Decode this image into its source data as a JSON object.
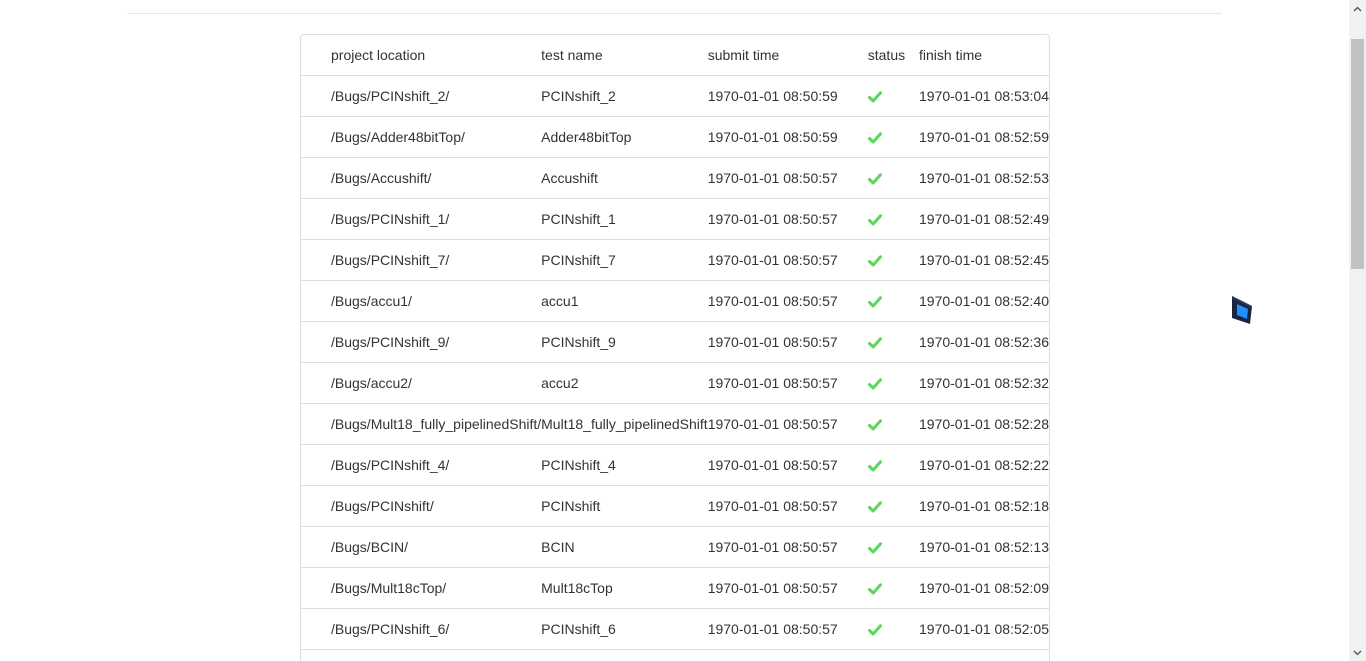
{
  "table": {
    "headers": {
      "project_location": "project location",
      "test_name": "test name",
      "submit_time": "submit time",
      "status": "status",
      "finish_time": "finish time"
    },
    "rows": [
      {
        "location": "/Bugs/PCINshift_2/",
        "name": "PCINshift_2",
        "submit": "1970-01-01 08:50:59",
        "status": "success",
        "finish": "1970-01-01 08:53:04"
      },
      {
        "location": "/Bugs/Adder48bitTop/",
        "name": "Adder48bitTop",
        "submit": "1970-01-01 08:50:59",
        "status": "success",
        "finish": "1970-01-01 08:52:59"
      },
      {
        "location": "/Bugs/Accushift/",
        "name": "Accushift",
        "submit": "1970-01-01 08:50:57",
        "status": "success",
        "finish": "1970-01-01 08:52:53"
      },
      {
        "location": "/Bugs/PCINshift_1/",
        "name": "PCINshift_1",
        "submit": "1970-01-01 08:50:57",
        "status": "success",
        "finish": "1970-01-01 08:52:49"
      },
      {
        "location": "/Bugs/PCINshift_7/",
        "name": "PCINshift_7",
        "submit": "1970-01-01 08:50:57",
        "status": "success",
        "finish": "1970-01-01 08:52:45"
      },
      {
        "location": "/Bugs/accu1/",
        "name": "accu1",
        "submit": "1970-01-01 08:50:57",
        "status": "success",
        "finish": "1970-01-01 08:52:40"
      },
      {
        "location": "/Bugs/PCINshift_9/",
        "name": "PCINshift_9",
        "submit": "1970-01-01 08:50:57",
        "status": "success",
        "finish": "1970-01-01 08:52:36"
      },
      {
        "location": "/Bugs/accu2/",
        "name": "accu2",
        "submit": "1970-01-01 08:50:57",
        "status": "success",
        "finish": "1970-01-01 08:52:32"
      },
      {
        "location": "/Bugs/Mult18_fully_pipelinedShift/",
        "name": "Mult18_fully_pipelinedShift",
        "submit": "1970-01-01 08:50:57",
        "status": "success",
        "finish": "1970-01-01 08:52:28"
      },
      {
        "location": "/Bugs/PCINshift_4/",
        "name": "PCINshift_4",
        "submit": "1970-01-01 08:50:57",
        "status": "success",
        "finish": "1970-01-01 08:52:22"
      },
      {
        "location": "/Bugs/PCINshift/",
        "name": "PCINshift",
        "submit": "1970-01-01 08:50:57",
        "status": "success",
        "finish": "1970-01-01 08:52:18"
      },
      {
        "location": "/Bugs/BCIN/",
        "name": "BCIN",
        "submit": "1970-01-01 08:50:57",
        "status": "success",
        "finish": "1970-01-01 08:52:13"
      },
      {
        "location": "/Bugs/Mult18cTop/",
        "name": "Mult18cTop",
        "submit": "1970-01-01 08:50:57",
        "status": "success",
        "finish": "1970-01-01 08:52:09"
      },
      {
        "location": "/Bugs/PCINshift_6/",
        "name": "PCINshift_6",
        "submit": "1970-01-01 08:50:57",
        "status": "success",
        "finish": "1970-01-01 08:52:05"
      }
    ]
  },
  "colors": {
    "check": "#5cd65c",
    "border": "#dddddd",
    "text": "#333333",
    "logo_dark": "#1a2540",
    "logo_accent": "#1e90ff"
  },
  "icons": {
    "status_success": "check-icon",
    "floating": "cube-logo-icon"
  }
}
